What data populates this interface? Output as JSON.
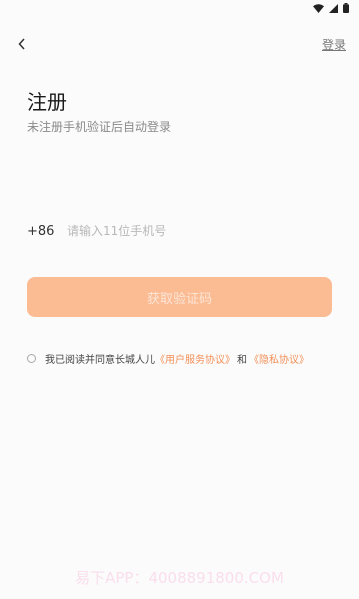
{
  "header": {
    "login_label": "登录"
  },
  "main": {
    "title": "注册",
    "subtitle": "未注册手机验证后自动登录"
  },
  "phone": {
    "country_code": "+86",
    "placeholder": "请输入11位手机号",
    "value": ""
  },
  "button": {
    "get_code_label": "获取验证码"
  },
  "agreement": {
    "prefix": "我已阅读并同意长城人儿",
    "user_agreement": "《用户服务协议》",
    "and": "和",
    "privacy_policy": "《隐私协议》",
    "checked": false
  },
  "watermark": {
    "text": "易下APP：4008891800.COM"
  },
  "colors": {
    "accent": "#f29058",
    "button_bg": "#fbbb93",
    "background": "#fbfbfb"
  },
  "icons": [
    "wifi-icon",
    "signal-icon",
    "battery-icon",
    "back-arrow-icon"
  ]
}
